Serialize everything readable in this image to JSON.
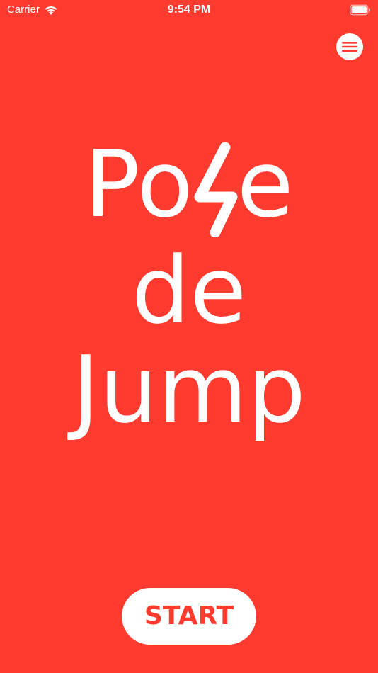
{
  "status_bar": {
    "carrier": "Carrier",
    "time": "9:54 PM"
  },
  "header": {
    "menu_icon": "hamburger-menu-icon"
  },
  "logo": {
    "line1_before": "Po",
    "line1_after": "e",
    "line1_glyph_icon": "lightning-bolt-icon",
    "line2": "de",
    "line3": "Jump"
  },
  "start_button": {
    "label": "START"
  },
  "colors": {
    "background": "#FF3B30",
    "foreground": "#FFFFFF"
  }
}
